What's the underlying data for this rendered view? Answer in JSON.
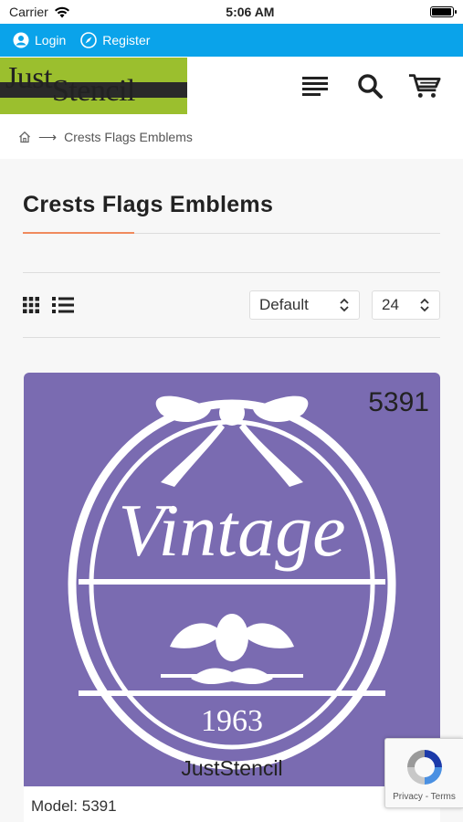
{
  "status_bar": {
    "carrier": "Carrier",
    "time": "5:06 AM",
    "battery_level": 0.95
  },
  "top_bar": {
    "login_label": "Login",
    "register_label": "Register"
  },
  "header": {
    "logo_text_1": "Just",
    "logo_text_2": "Stencil"
  },
  "breadcrumb": {
    "arrow": "⟶",
    "current": "Crests Flags Emblems"
  },
  "page": {
    "title": "Crests Flags Emblems"
  },
  "toolbar": {
    "sort_value": "Default",
    "limit_value": "24"
  },
  "product": {
    "code": "5391",
    "stencil_word": "Vintage",
    "stencil_year": "1963",
    "watermark": "JustStencil",
    "model_label": "Model: 5391"
  },
  "recaptcha": {
    "privacy": "Privacy",
    "separator": " - ",
    "terms": "Terms"
  },
  "colors": {
    "top_bar": "#0aa3ea",
    "accent_rule": "#f08a5d",
    "product_bg": "#7a6bb1",
    "logo_green": "#9bbf2e"
  }
}
